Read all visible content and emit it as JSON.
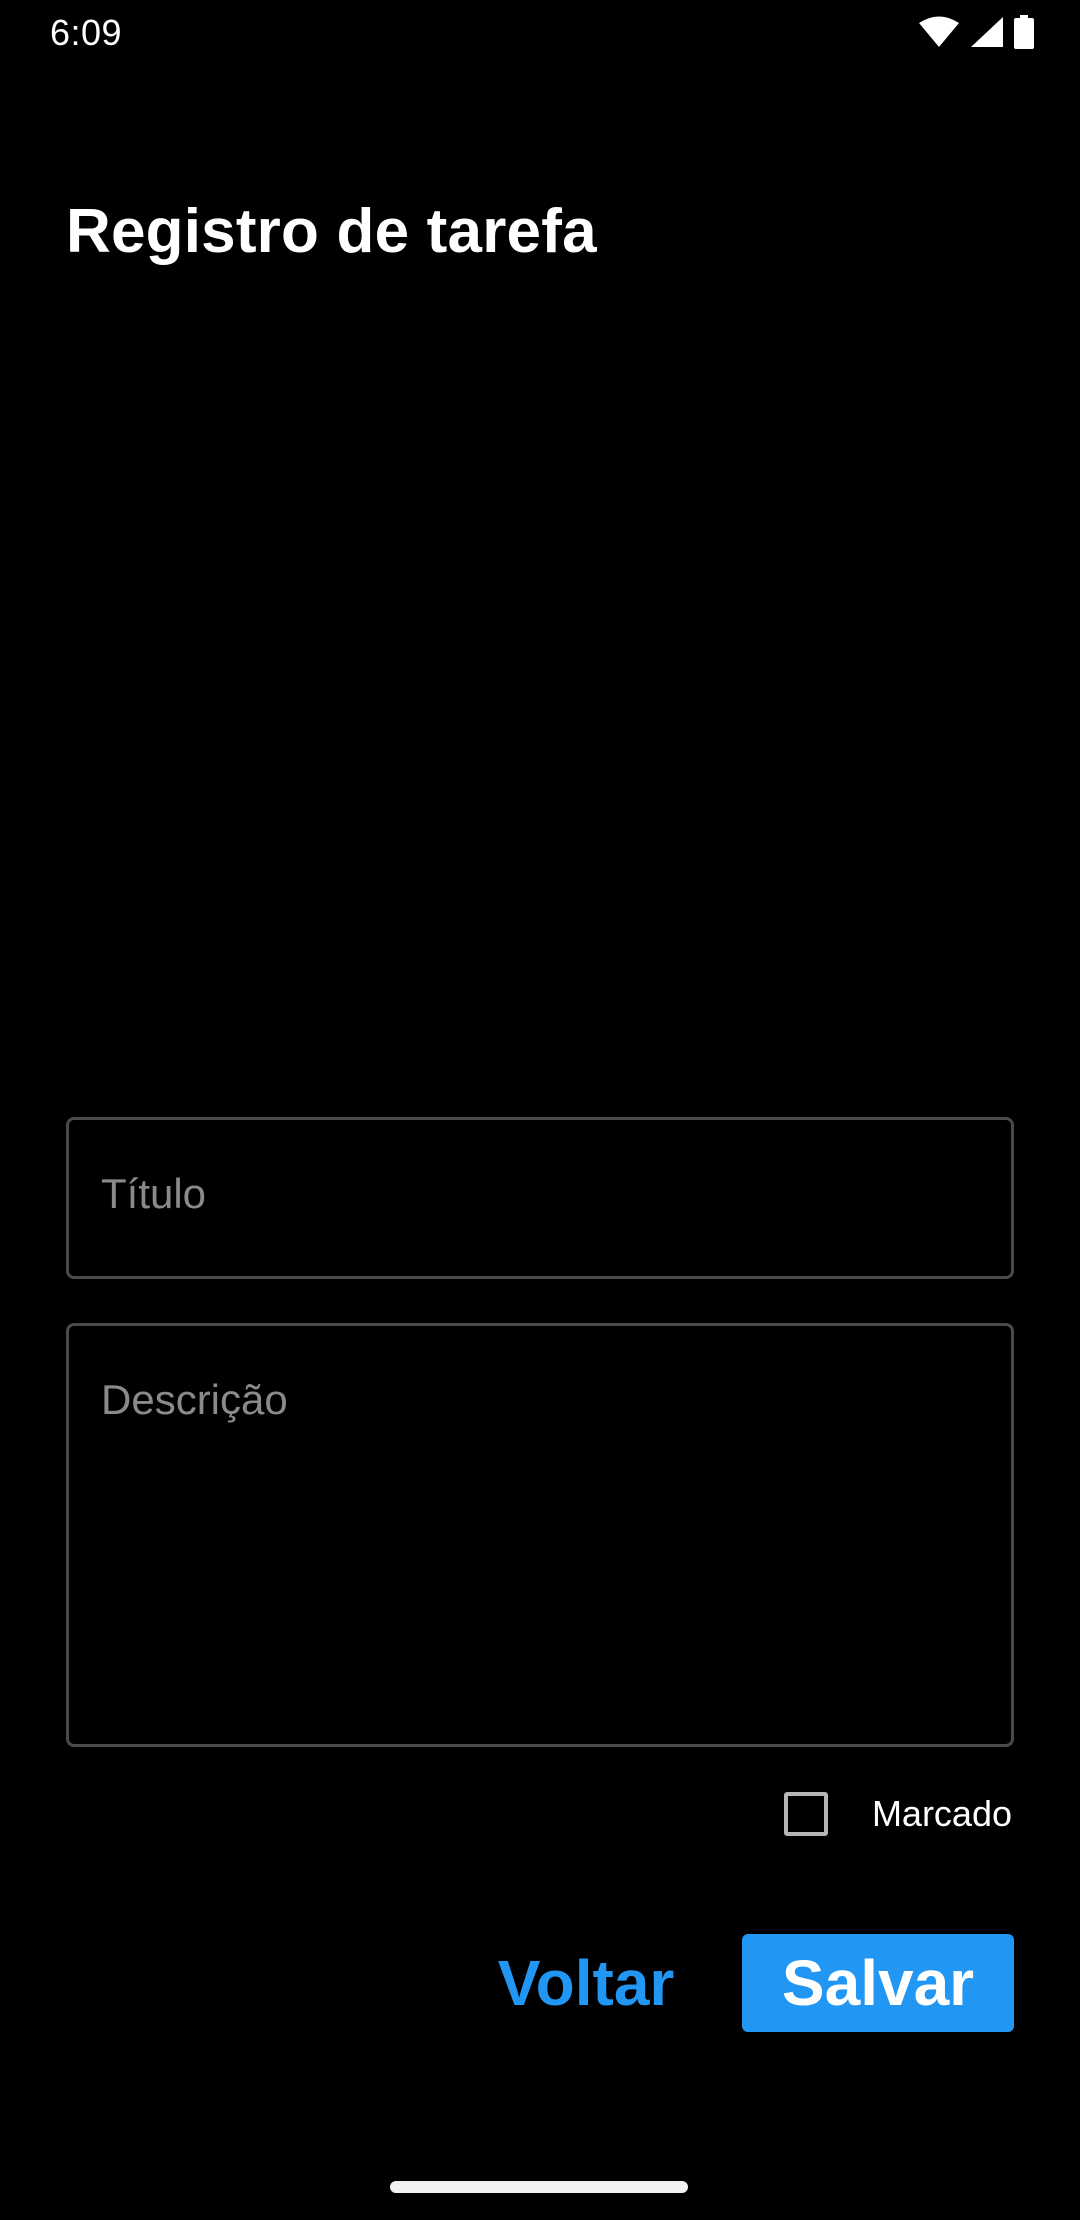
{
  "status_bar": {
    "time": "6:09",
    "icons": [
      "wifi-icon",
      "signal-icon",
      "battery-icon"
    ]
  },
  "page": {
    "title": "Registro de tarefa"
  },
  "form": {
    "title_placeholder": "Título",
    "description_placeholder": "Descrição",
    "checkbox_label": "Marcado",
    "checkbox_checked": false
  },
  "actions": {
    "back_label": "Voltar",
    "save_label": "Salvar"
  },
  "colors": {
    "background": "#000000",
    "accent": "#2196f3",
    "text": "#ffffff",
    "placeholder": "#8a8a8a",
    "border": "#4a4a4a"
  }
}
